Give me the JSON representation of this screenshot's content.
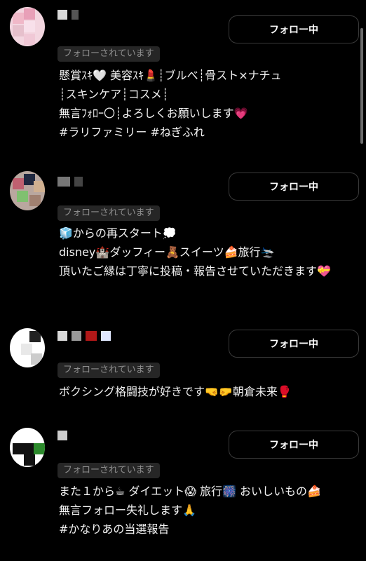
{
  "users": [
    {
      "follow_label": "フォロー中",
      "followed_badge": "フォローされています",
      "bio": "懸賞ｽｷ🤍 美容ｽｷ💄┊ブルべ┊骨スト×ナチュ\n┊スキンケア┊コスメ┊\n無言ﾌｫﾛｰ〇┊よろしくお願いします💗\n#ラリファミリー #ねぎふれ"
    },
    {
      "follow_label": "フォロー中",
      "followed_badge": "フォローされています",
      "bio": "🧊からの再スタート💭\ndisney🏰ダッフィー🧸スイーツ🍰旅行🛬\n頂いたご縁は丁寧に投稿・報告させていただきます💝"
    },
    {
      "follow_label": "フォロー中",
      "followed_badge": "フォローされています",
      "bio": "ボクシング格闘技が好きです🤜🤛朝倉未来🥊"
    },
    {
      "follow_label": "フォロー中",
      "followed_badge": "フォローされています",
      "bio": "また１から☕ ダイエット😱 旅行🎆 おいしいもの🍰\n無言フォロー失礼します🙏\n#かなりあの当選報告"
    }
  ],
  "colors": {
    "background": "#000000",
    "button_border": "#3a3a3a",
    "badge_bg": "#262626",
    "badge_text": "#8e8e8e"
  }
}
